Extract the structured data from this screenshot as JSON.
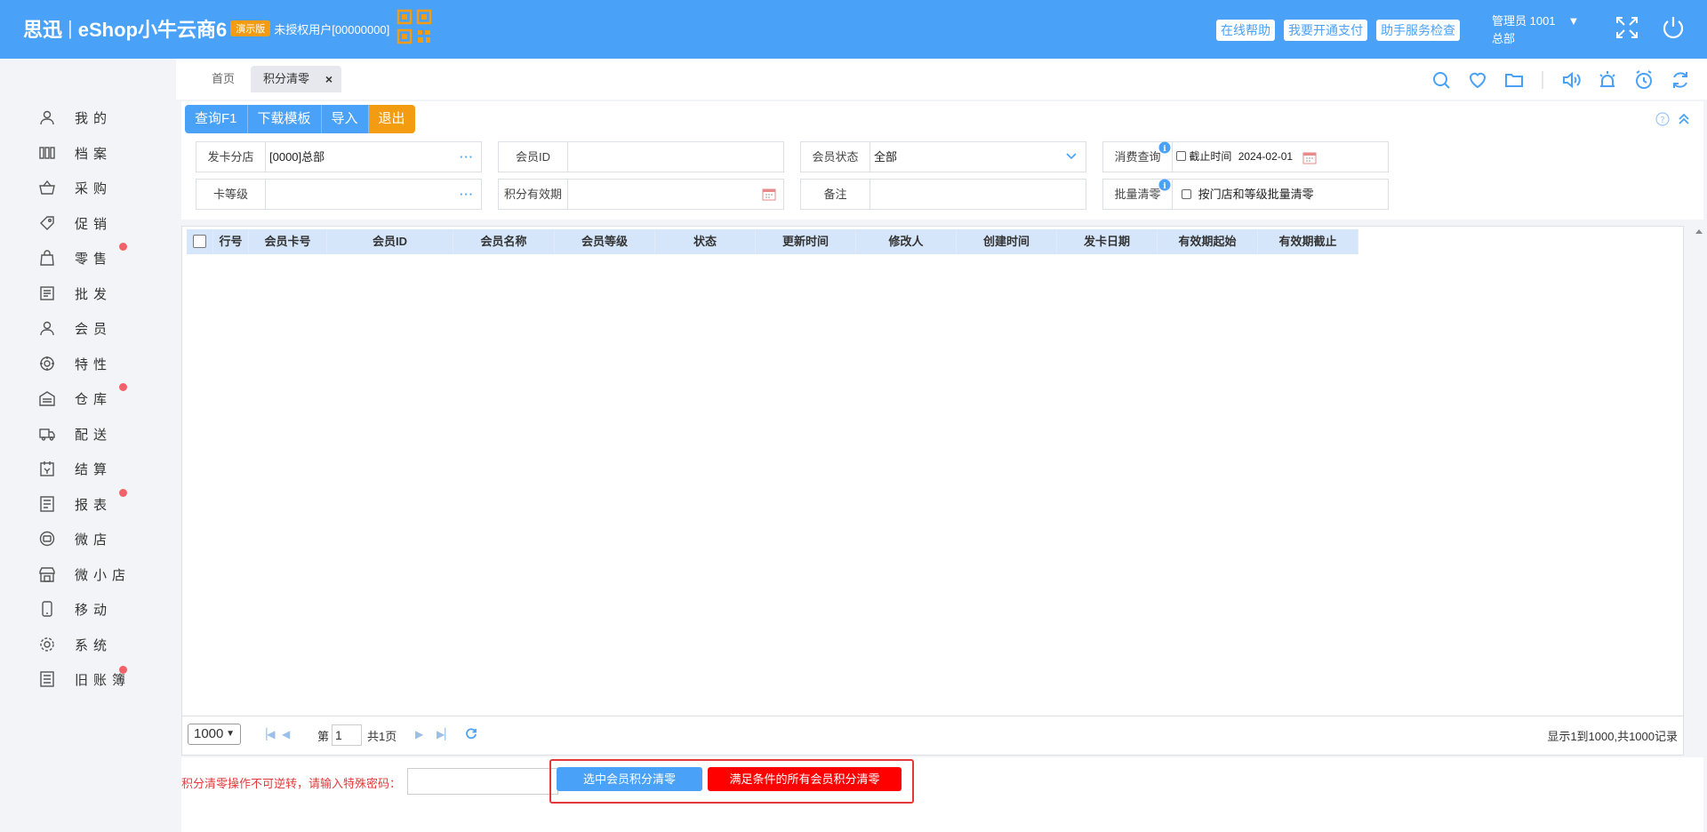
{
  "header": {
    "brand_cn": "思迅",
    "brand_en": "eShop小牛云商6",
    "demo_badge": "演示版",
    "unauth": "未授权用户[00000000]",
    "buttons": [
      "在线帮助",
      "我要开通支付",
      "助手服务检查"
    ],
    "admin_name": "管理员 1001",
    "admin_arrow": "▼",
    "admin_branch": "总部",
    "accent": "#4aa1f8"
  },
  "sidebar": {
    "items": [
      {
        "label": "我的",
        "icon": "user-icon",
        "dot": false
      },
      {
        "label": "档案",
        "icon": "archive-icon",
        "dot": false
      },
      {
        "label": "采购",
        "icon": "basket-icon",
        "dot": false
      },
      {
        "label": "促销",
        "icon": "tag-icon",
        "dot": false
      },
      {
        "label": "零售",
        "icon": "bag-icon",
        "dot": true
      },
      {
        "label": "批发",
        "icon": "wholesale-icon",
        "dot": false
      },
      {
        "label": "会员",
        "icon": "member-icon",
        "dot": false
      },
      {
        "label": "特性",
        "icon": "feature-icon",
        "dot": false
      },
      {
        "label": "仓库",
        "icon": "warehouse-icon",
        "dot": true
      },
      {
        "label": "配送",
        "icon": "truck-icon",
        "dot": false
      },
      {
        "label": "结算",
        "icon": "settle-icon",
        "dot": false
      },
      {
        "label": "报表",
        "icon": "report-icon",
        "dot": true
      },
      {
        "label": "微店",
        "icon": "microshop-icon",
        "dot": false
      },
      {
        "label": "微小店",
        "icon": "store-icon",
        "dot": false
      },
      {
        "label": "移动",
        "icon": "mobile-icon",
        "dot": false
      },
      {
        "label": "系统",
        "icon": "gear-icon",
        "dot": false
      },
      {
        "label": "旧账簿",
        "icon": "ledger-icon",
        "dot": true
      }
    ]
  },
  "tabs": {
    "home": "首页",
    "active": "积分清零",
    "close": "×"
  },
  "toolbar": {
    "query": "查询F1",
    "download": "下载模板",
    "import": "导入",
    "exit": "退出"
  },
  "filters": {
    "card_branch_label": "发卡分店",
    "card_branch_value": "[0000]总部",
    "member_id_label": "会员ID",
    "member_id_value": "",
    "member_status_label": "会员状态",
    "member_status_value": "全部",
    "consume_query_label": "消费查询",
    "deadline_label": "截止时间",
    "deadline_value": "2024-02-01",
    "card_level_label": "卡等级",
    "card_level_value": "",
    "points_valid_label": "积分有效期",
    "points_valid_value": "",
    "remark_label": "备注",
    "remark_value": "",
    "batch_clear_label": "批量清零",
    "batch_clear_option": "按门店和等级批量清零"
  },
  "grid": {
    "columns": [
      "行号",
      "会员卡号",
      "会员ID",
      "会员名称",
      "会员等级",
      "状态",
      "更新时间",
      "修改人",
      "创建时间",
      "发卡日期",
      "有效期起始",
      "有效期截止"
    ],
    "rows": []
  },
  "pager": {
    "page_size": "1000",
    "page_prefix": "第",
    "page_value": "1",
    "total_pages": "共1页",
    "summary": "显示1到1000,共1000记录"
  },
  "bottom": {
    "warning": "积分清零操作不可逆转，请输入特殊密码：",
    "password": "",
    "clear_selected": "选中会员积分清零",
    "clear_all": "满足条件的所有会员积分清零",
    "danger_color": "#ff0000"
  }
}
